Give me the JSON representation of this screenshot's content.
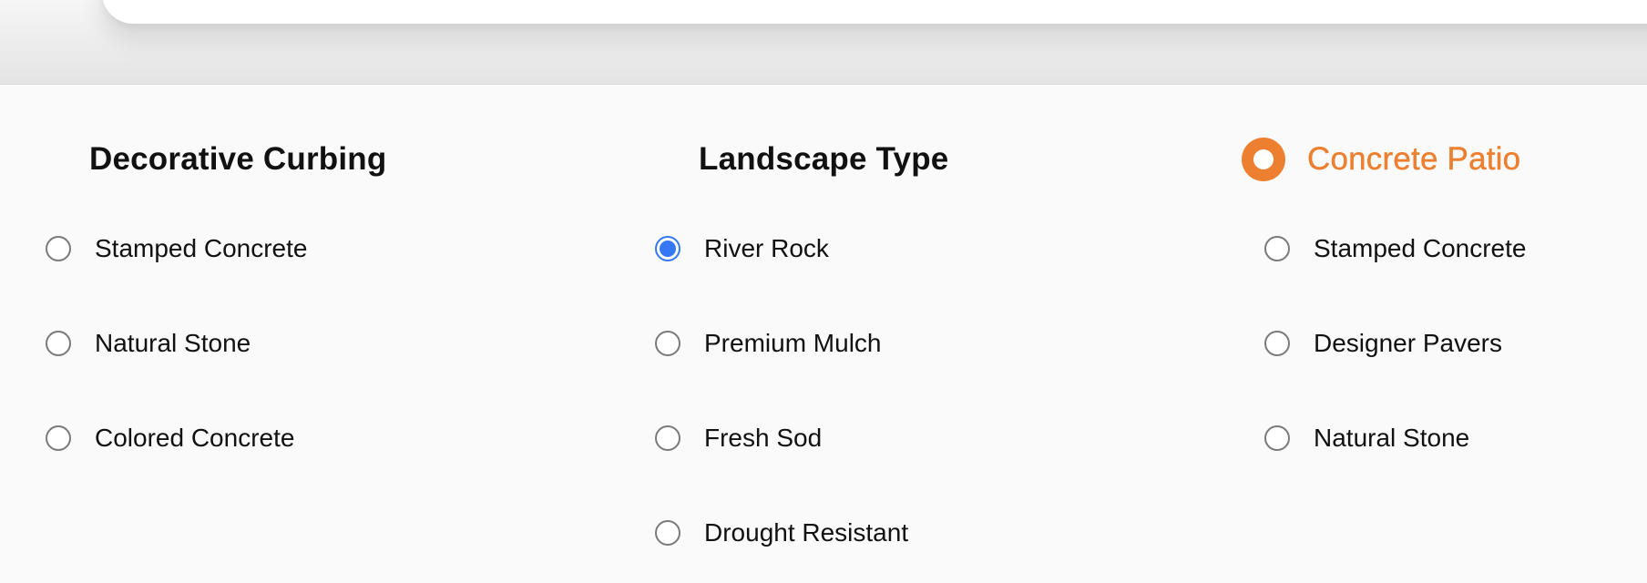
{
  "groups": [
    {
      "title": "Decorative Curbing",
      "accent": false,
      "options": [
        {
          "label": "Stamped Concrete",
          "checked": false
        },
        {
          "label": "Natural Stone",
          "checked": false
        },
        {
          "label": "Colored Concrete",
          "checked": false
        }
      ]
    },
    {
      "title": "Landscape Type",
      "accent": false,
      "options": [
        {
          "label": "River Rock",
          "checked": true
        },
        {
          "label": "Premium Mulch",
          "checked": false
        },
        {
          "label": "Fresh Sod",
          "checked": false
        },
        {
          "label": "Drought Resistant",
          "checked": false
        }
      ]
    },
    {
      "title": "Concrete Patio",
      "accent": true,
      "selected": true,
      "options": [
        {
          "label": "Stamped Concrete",
          "checked": false
        },
        {
          "label": "Designer Pavers",
          "checked": false
        },
        {
          "label": "Natural Stone",
          "checked": false
        }
      ]
    }
  ],
  "colors": {
    "accent": "#ec8030",
    "radio_checked": "#3478f6",
    "radio_border": "#7a7a7a",
    "text": "#111111"
  }
}
